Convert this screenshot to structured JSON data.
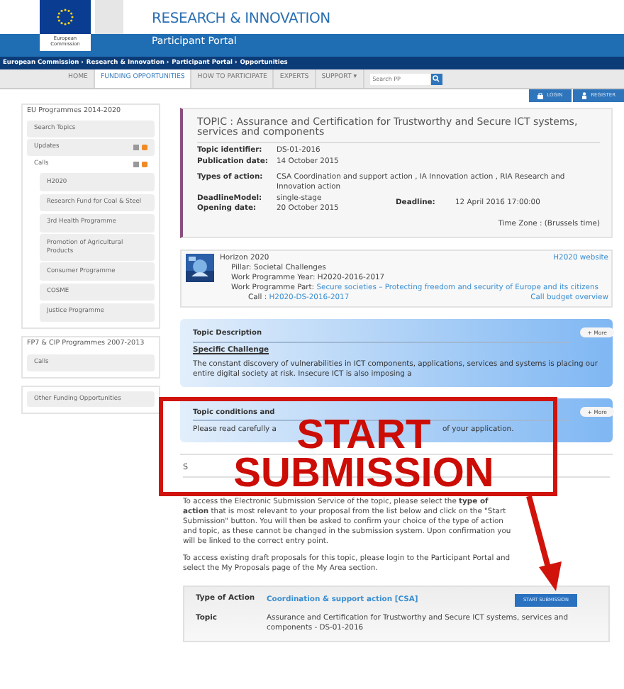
{
  "header": {
    "org": "European Commission",
    "title": "RESEARCH & INNOVATION",
    "portal": "Participant Portal",
    "breadcrumb": [
      "European Commission ›",
      "Research & Innovation ›",
      "Participant Portal ›",
      "Opportunities"
    ]
  },
  "nav": [
    {
      "label": "HOME",
      "selected": false
    },
    {
      "label": "FUNDING OPPORTUNITIES",
      "selected": true
    },
    {
      "label": "HOW TO PARTICIPATE",
      "selected": false
    },
    {
      "label": "EXPERTS",
      "selected": false
    },
    {
      "label": "SUPPORT ▾",
      "selected": false
    }
  ],
  "search": {
    "placeholder": "Search PP"
  },
  "account": [
    "LOGIN",
    "REGISTER"
  ],
  "sidebar": [
    {
      "title": "EU Programmes 2014-2020",
      "items": [
        {
          "label": "Search Topics",
          "feeds": false,
          "expanded": false
        },
        {
          "label": "Updates",
          "feeds": true,
          "expanded": false
        },
        {
          "label": "Calls",
          "feeds": true,
          "expanded": true,
          "children": [
            "H2020",
            "Research Fund for Coal & Steel",
            "3rd Health Programme",
            "Promotion of Agricultural Products",
            "Consumer Programme",
            "COSME",
            "Justice Programme"
          ]
        }
      ]
    },
    {
      "title": "FP7 & CIP Programmes 2007-2013",
      "items": [
        {
          "label": "Calls",
          "feeds": false,
          "expanded": false
        }
      ]
    },
    {
      "items": [
        {
          "label": "Other Funding Opportunities",
          "feeds": false,
          "expanded": false
        }
      ]
    }
  ],
  "topic": {
    "title": "TOPIC : Assurance and Certification for Trustworthy and Secure ICT systems, services and components",
    "identifier": {
      "label": "Topic identifier:",
      "value": "DS-01-2016"
    },
    "publication": {
      "label": "Publication date:",
      "value": "14 October 2015"
    },
    "types": {
      "label": "Types of action:",
      "value": "CSA Coordination and support action , IA Innovation action , RIA Research and Innovation action"
    },
    "model": {
      "label": "DeadlineModel:",
      "value": "single-stage"
    },
    "opening": {
      "label": "Opening date:",
      "value": "20 October 2015"
    },
    "deadline": {
      "label": "Deadline:",
      "value": "12 April 2016 17:00:00"
    },
    "timezone": "Time Zone : (Brussels time)"
  },
  "programme": {
    "name": "Horizon 2020",
    "pillar": "Pillar: Societal Challenges",
    "year": "Work Programme Year: H2020-2016-2017",
    "part_label": "Work Programme Part:",
    "part": "Secure societies – Protecting freedom and security of Europe and its citizens",
    "call_label": "Call :",
    "call": "H2020-DS-2016-2017",
    "website": "H2020 website",
    "budget": "Call budget overview"
  },
  "panels": [
    {
      "title": "Topic Description",
      "more": "+ More",
      "subtitle": "Specific Challenge",
      "text": [
        "The constant discovery of vulnerabilities in ICT components, applications, services and systems is placing our entire digital society at risk. Insecure ICT is also imposing a"
      ]
    },
    {
      "title": "Topic conditions and",
      "more": "+ More",
      "text": [
        "Please read carefully a",
        "of your application."
      ]
    }
  ],
  "submission": {
    "title": "S",
    "paragraphs": [
      "To access the Electronic Submission Service of the topic, please select the **type of action** that is most relevant to your proposal from the list below and click on the \"Start Submission\" button. You will then be asked to confirm your choice of the type of action and topic, as these cannot be changed in the submission system. Upon confirmation you will be linked to the correct entry point.",
      "To access existing draft proposals for this topic, please login to the Participant Portal and select the My Proposals page of the My Area section."
    ],
    "type_label": "Type of Action",
    "type_value": "Coordination & support action [CSA]",
    "button": "START SUBMISSION",
    "topic_label": "Topic",
    "topic_value": "Assurance and Certification for Trustworthy and Secure ICT systems, services and components - DS-01-2016"
  },
  "annotation": {
    "lines": [
      "START",
      "SUBMISSION"
    ]
  }
}
